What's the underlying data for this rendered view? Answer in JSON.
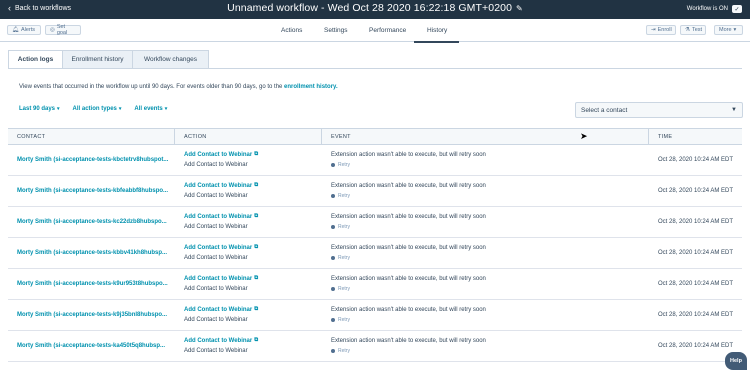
{
  "topbar": {
    "back_label": "Back to workflows",
    "title": "Unnamed workflow - Wed Oct 28 2020 16:22:18 GMT+0200",
    "status_label": "Workflow is ON"
  },
  "toolbar": {
    "alerts_label": "Alerts",
    "set_goal_label": "Set goal",
    "enroll_label": "Enroll",
    "test_label": "Test",
    "more_label": "More"
  },
  "nav": {
    "tabs": [
      "Actions",
      "Settings",
      "Performance",
      "History"
    ],
    "active": "History"
  },
  "subtabs": [
    "Action logs",
    "Enrollment history",
    "Workflow changes"
  ],
  "description": {
    "text": "View events that occurred in the workflow up until 90 days. For events older than 90 days, go to the ",
    "link": "enrollment history."
  },
  "filters": [
    "Last 90 days",
    "All action types",
    "All events"
  ],
  "contact_select": {
    "placeholder": "Select a contact"
  },
  "table": {
    "headers": [
      "CONTACT",
      "ACTION",
      "EVENT",
      "TIME"
    ],
    "rows": [
      {
        "contact": "Morty Smith (si-acceptance-tests-kbctetrv8hubspot...",
        "action_link": "Add Contact to Webinar",
        "action_sub": "Add Contact to Webinar",
        "event": "Extension action wasn't able to execute, but will retry soon",
        "status": "Retry",
        "time": "Oct 28, 2020 10:24 AM EDT"
      },
      {
        "contact": "Morty Smith (si-acceptance-tests-kbfeabbf8hubspo...",
        "action_link": "Add Contact to Webinar",
        "action_sub": "Add Contact to Webinar",
        "event": "Extension action wasn't able to execute, but will retry soon",
        "status": "Retry",
        "time": "Oct 28, 2020 10:24 AM EDT"
      },
      {
        "contact": "Morty Smith (si-acceptance-tests-kc22dzb8hubspo...",
        "action_link": "Add Contact to Webinar",
        "action_sub": "Add Contact to Webinar",
        "event": "Extension action wasn't able to execute, but will retry soon",
        "status": "Retry",
        "time": "Oct 28, 2020 10:24 AM EDT"
      },
      {
        "contact": "Morty Smith (si-acceptance-tests-kbbv41kh8hubsp...",
        "action_link": "Add Contact to Webinar",
        "action_sub": "Add Contact to Webinar",
        "event": "Extension action wasn't able to execute, but will retry soon",
        "status": "Retry",
        "time": "Oct 28, 2020 10:24 AM EDT"
      },
      {
        "contact": "Morty Smith (si-acceptance-tests-k9ur953t8hubspo...",
        "action_link": "Add Contact to Webinar",
        "action_sub": "Add Contact to Webinar",
        "event": "Extension action wasn't able to execute, but will retry soon",
        "status": "Retry",
        "time": "Oct 28, 2020 10:24 AM EDT"
      },
      {
        "contact": "Morty Smith (si-acceptance-tests-k9j35bnl8hubspo...",
        "action_link": "Add Contact to Webinar",
        "action_sub": "Add Contact to Webinar",
        "event": "Extension action wasn't able to execute, but will retry soon",
        "status": "Retry",
        "time": "Oct 28, 2020 10:24 AM EDT"
      },
      {
        "contact": "Morty Smith (si-acceptance-tests-ka450t5q8hubsp...",
        "action_link": "Add Contact to Webinar",
        "action_sub": "Add Contact to Webinar",
        "event": "Extension action wasn't able to execute, but will retry soon",
        "status": "Retry",
        "time": "Oct 28, 2020 10:24 AM EDT"
      }
    ]
  },
  "help_label": "Help",
  "icons": {
    "back": "chevron-left-icon",
    "edit": "pencil-icon",
    "external": "external-link-icon",
    "caret": "caret-down-icon"
  },
  "colors": {
    "topbar": "#213343",
    "link": "#0091ae",
    "text": "#33475b",
    "border": "#cbd6e2"
  }
}
